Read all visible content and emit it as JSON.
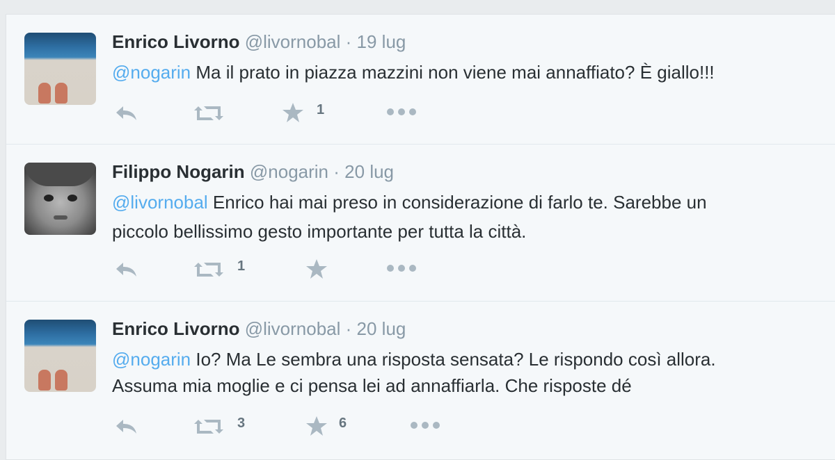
{
  "tweets": [
    {
      "name": "Enrico Livorno",
      "handle": "@livornobal",
      "time": "19 lug",
      "mention": "@nogarin",
      "line1": "Ma il prato in piazza mazzini non viene mai annaffiato? È giallo!!!",
      "line2": "",
      "retweets": "",
      "favorites": "1",
      "avatar": "beach-photo"
    },
    {
      "name": "Filippo Nogarin",
      "handle": "@nogarin",
      "time": "20 lug",
      "mention": "@livornobal",
      "line1": "Enrico hai mai preso in considerazione di farlo te. Sarebbe un",
      "line2": "piccolo bellissimo gesto importante per tutta la città.",
      "retweets": "1",
      "favorites": "",
      "avatar": "child-photo"
    },
    {
      "name": "Enrico Livorno",
      "handle": "@livornobal",
      "time": "20 lug",
      "mention": "@nogarin",
      "line1": "Io? Ma Le sembra una risposta sensata? Le rispondo così allora.",
      "line2": "Assuma mia moglie e ci pensa lei ad annaffiarla. Che risposte dé",
      "retweets": "3",
      "favorites": "6",
      "avatar": "beach-photo"
    }
  ],
  "separator": "·",
  "icons": {
    "reply": "reply-icon",
    "retweet": "retweet-icon",
    "favorite": "star-icon",
    "more": "more-icon"
  },
  "colors": {
    "link": "#55acee",
    "name": "#292f33",
    "muted": "#8899a6",
    "icon": "#aab8c2"
  }
}
